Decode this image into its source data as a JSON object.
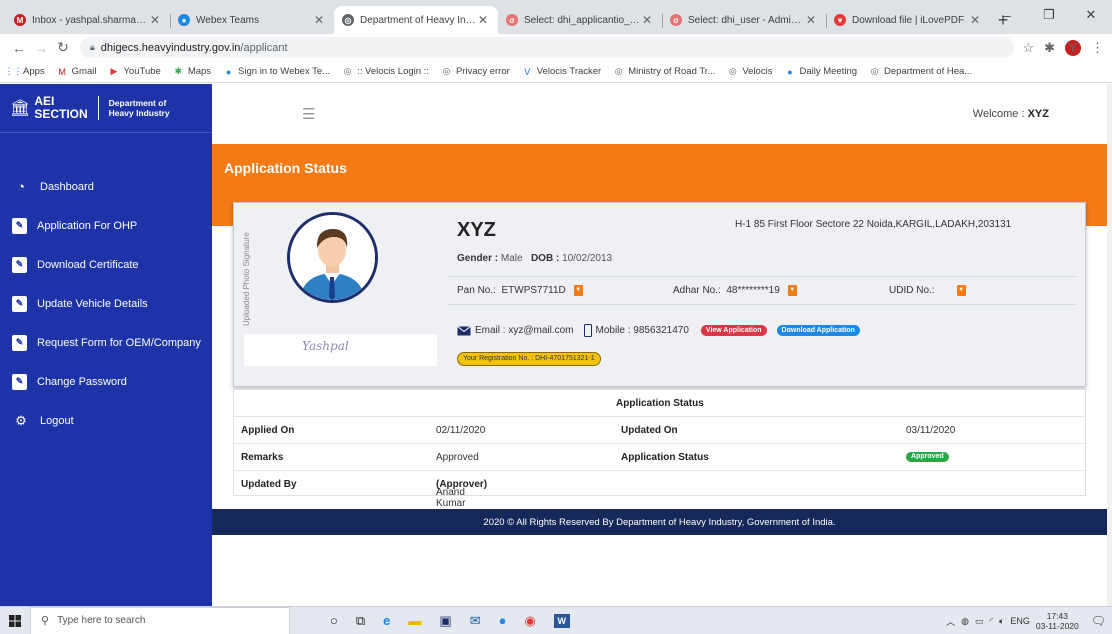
{
  "browser": {
    "tabs": [
      {
        "title": "Inbox - yashpal.sharma@velc",
        "icon": "gmail-icon",
        "color": "#c5221f",
        "glyph": "M"
      },
      {
        "title": "Webex Teams",
        "icon": "webex-icon",
        "color": "#1e88e5",
        "glyph": "●"
      },
      {
        "title": "Department of Heavy Industr",
        "icon": "globe-icon",
        "color": "#5f6368",
        "glyph": "◎"
      },
      {
        "title": "Select: dhi_applicantio_form",
        "icon": "adminer-icon",
        "color": "#e57373",
        "glyph": "σ"
      },
      {
        "title": "Select: dhi_user - Adminer",
        "icon": "adminer-icon",
        "color": "#e57373",
        "glyph": "σ"
      },
      {
        "title": "Download file | iLovePDF",
        "icon": "ilovepdf-icon",
        "color": "#e53935",
        "glyph": "♥"
      }
    ],
    "new_tab": "+",
    "address": {
      "host": "dhigecs.heavyindustry.gov.in",
      "path": "/applicant"
    },
    "profile_initial": "Y",
    "bookmarks": [
      {
        "label": "Apps",
        "icon": "apps-grid-icon",
        "glyph": "⋮⋮",
        "color": "#1a73e8"
      },
      {
        "label": "Gmail",
        "icon": "gmail-icon",
        "glyph": "M",
        "color": "#c5221f"
      },
      {
        "label": "YouTube",
        "icon": "youtube-icon",
        "glyph": "▶",
        "color": "#e53935"
      },
      {
        "label": "Maps",
        "icon": "maps-icon",
        "glyph": "✱",
        "color": "#34a853"
      },
      {
        "label": "Sign in to Webex Te...",
        "icon": "webex-icon",
        "glyph": "●",
        "color": "#1e88e5"
      },
      {
        "label": ":: Velocis Login ::",
        "icon": "globe-icon",
        "glyph": "◎",
        "color": "#5f6368"
      },
      {
        "label": "Privacy error",
        "icon": "globe-icon",
        "glyph": "◎",
        "color": "#5f6368"
      },
      {
        "label": "Velocis Tracker",
        "icon": "velocis-icon",
        "glyph": "V",
        "color": "#1a73e8"
      },
      {
        "label": "Ministry of Road Tr...",
        "icon": "globe-icon",
        "glyph": "◎",
        "color": "#5f6368"
      },
      {
        "label": "Velocis",
        "icon": "globe-icon",
        "glyph": "◎",
        "color": "#5f6368"
      },
      {
        "label": "Daily Meeting",
        "icon": "meeting-icon",
        "glyph": "●",
        "color": "#1e88e5"
      },
      {
        "label": "Department of Hea...",
        "icon": "globe-icon",
        "glyph": "◎",
        "color": "#5f6368"
      }
    ]
  },
  "sidebar": {
    "logo_main_1": "AEI",
    "logo_main_2": "SECTION",
    "logo_sub_1": "Department of",
    "logo_sub_2": "Heavy Industry",
    "items": [
      {
        "label": "Dashboard",
        "icon": "dashboard-icon"
      },
      {
        "label": "Application For OHP",
        "icon": "document-edit-icon"
      },
      {
        "label": "Download Certificate",
        "icon": "document-edit-icon"
      },
      {
        "label": "Update Vehicle Details",
        "icon": "document-edit-icon"
      },
      {
        "label": "Request Form for OEM/Company",
        "icon": "document-edit-icon"
      },
      {
        "label": "Change Password",
        "icon": "document-edit-icon"
      },
      {
        "label": "Logout",
        "icon": "gear-icon"
      }
    ]
  },
  "header": {
    "welcome_label": "Welcome :",
    "welcome_user": "XYZ"
  },
  "page": {
    "title": "Application Status"
  },
  "profile": {
    "photo_caption": "Uploaded Photo Signature",
    "signature": "Yashpal",
    "name": "XYZ",
    "address": "H-1 85 First Floor Sectore 22 Noida,KARGIL,LADAKH,203131",
    "gender_label": "Gender :",
    "gender": "Male",
    "dob_label": "DOB :",
    "dob": "10/02/2013",
    "pan_label": "Pan No.:",
    "pan": "ETWPS7711D",
    "adhar_label": "Adhar No.:",
    "adhar": "48********19",
    "udid_label": "UDID No.:",
    "email_label": "Email :",
    "email": "xyz@mail.com",
    "mobile_label": "Mobile :",
    "mobile": "9856321470",
    "view_btn": "View Application",
    "download_btn": "Download Application",
    "registration": "Your Registration No. : DHI-4701751321-1"
  },
  "status_table": {
    "header": "Application Status",
    "applied_on_label": "Applied On",
    "applied_on": "02/11/2020",
    "updated_on_label": "Updated On",
    "updated_on": "03/11/2020",
    "remarks_label": "Remarks",
    "remarks": "Approved",
    "status_label": "Application Status",
    "status": "Approved",
    "updated_by_label": "Updated By",
    "updated_by": "Anand Kumar Singh",
    "updated_by_role": "(Approver)"
  },
  "footer": {
    "text": "2020 © All Rights Reserved By Department of Heavy Industry, Government of India."
  },
  "taskbar": {
    "search_placeholder": "Type here to search",
    "tray_lang": "ENG",
    "time": "17:43",
    "date": "03-11-2020"
  }
}
